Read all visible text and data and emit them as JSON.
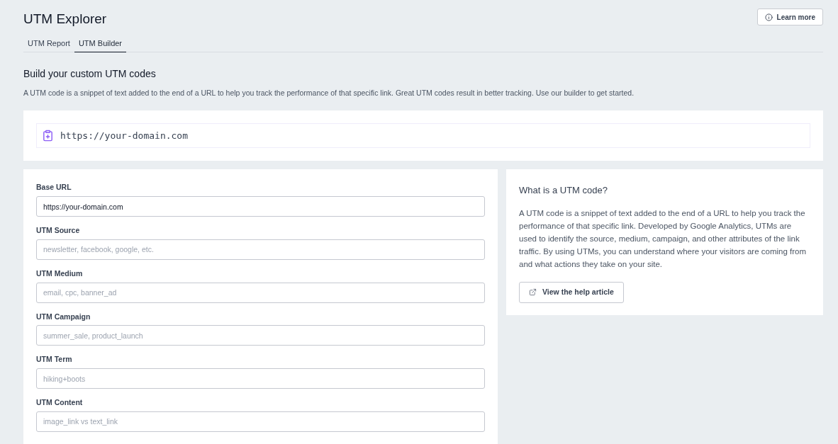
{
  "header": {
    "title": "UTM Explorer",
    "learn_more_button": "Learn more"
  },
  "tabs": [
    {
      "label": "UTM Report",
      "selected": false
    },
    {
      "label": "UTM Builder",
      "selected": true
    }
  ],
  "intro": {
    "heading": "Build your custom UTM codes",
    "description": "A UTM code is a snippet of text added to the end of a URL to help you track the performance of that specific link. Great UTM codes result in better tracking. Use our builder to get started."
  },
  "generated_url": "https://your-domain.com",
  "form_fields": [
    {
      "label": "Base URL",
      "value": "https://your-domain.com"
    },
    {
      "label": "UTM Source",
      "placeholder": "newsletter, facebook, google, etc."
    },
    {
      "label": "UTM Medium",
      "placeholder": "email, cpc, banner_ad"
    },
    {
      "label": "UTM Campaign",
      "placeholder": "summer_sale, product_launch"
    },
    {
      "label": "UTM Term",
      "placeholder": "hiking+boots"
    },
    {
      "label": "UTM Content",
      "placeholder": "image_link vs text_link"
    }
  ],
  "info_panel": {
    "title": "What is a UTM code?",
    "body": "A UTM code is a snippet of text added to the end of a URL to help you track the performance of that specific link. Developed by Google Analytics, UTMs are used to identify the source, medium, campaign, and other attributes of the link traffic. By using UTMs, you can understand where your visitors are coming from and what actions they take on your site.",
    "help_button": "View the help article"
  }
}
